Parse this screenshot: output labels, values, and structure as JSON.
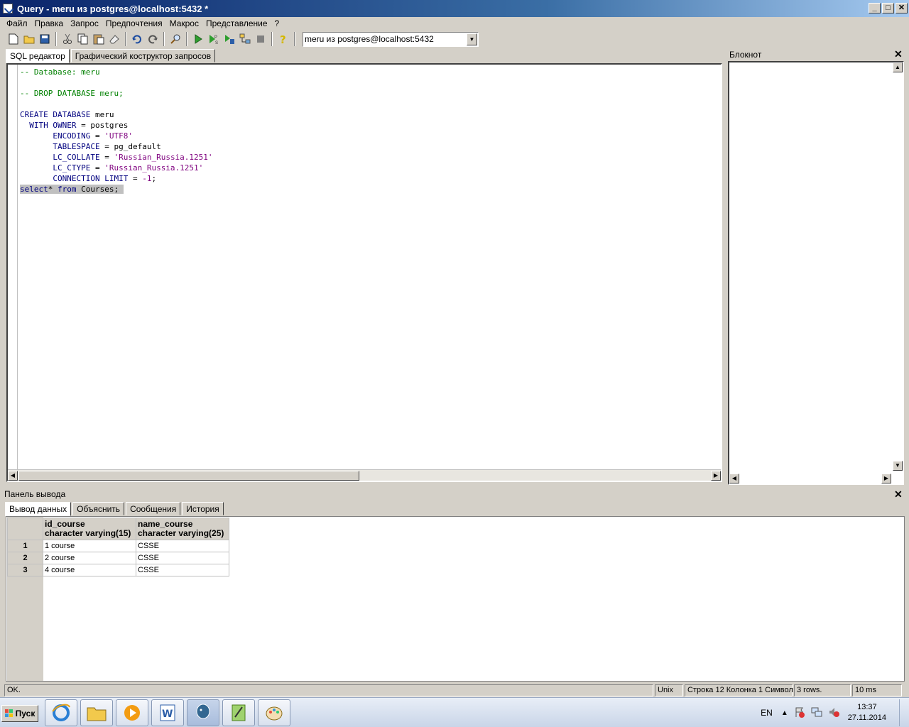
{
  "window": {
    "title": "Query - meru из postgres@localhost:5432 *",
    "buttons": [
      "_",
      "□",
      "✕"
    ]
  },
  "menu": [
    "Файл",
    "Правка",
    "Запрос",
    "Предпочтения",
    "Макрос",
    "Представление",
    "?"
  ],
  "toolbar": {
    "icons": [
      "new-file-icon",
      "open-folder-icon",
      "save-icon",
      "cut-icon",
      "copy-icon",
      "paste-icon",
      "clear-icon",
      "undo-icon",
      "redo-icon",
      "find-icon",
      "execute-icon",
      "execute-pgscript-icon",
      "execute-to-file-icon",
      "explain-icon",
      "stop-icon",
      "help-icon"
    ],
    "connection": "meru из postgres@localhost:5432"
  },
  "editor_tabs": [
    "SQL редактор",
    "Графический коструктор запросов"
  ],
  "editor": {
    "lines": {
      "l1": "-- Database: meru",
      "l3": "-- DROP DATABASE meru;",
      "l5_kw1": "CREATE",
      "l5_kw2": "DATABASE",
      "l5_name": "meru",
      "l6_kw1": "WITH",
      "l6_kw2": "OWNER",
      "l6_rest": "= postgres",
      "l7_kw": "ENCODING",
      "l7_eq": "=",
      "l7_str": "'UTF8'",
      "l8_kw": "TABLESPACE",
      "l8_rest": "= pg_default",
      "l9_kw": "LC_COLLATE",
      "l9_eq": "=",
      "l9_str": "'Russian_Russia.1251'",
      "l10_kw": "LC_CTYPE",
      "l10_eq": "=",
      "l10_str": "'Russian_Russia.1251'",
      "l11_kw": "CONNECTION LIMIT",
      "l11_eq": "=",
      "l11_num": "-1",
      "l11_end": ";",
      "l12_kw1": "select",
      "l12_mid": "* ",
      "l12_kw2": "from",
      "l12_rest": " Courses;"
    }
  },
  "notepad": {
    "title": "Блокнот",
    "close": "✕"
  },
  "output": {
    "title": "Панель вывода",
    "close": "✕",
    "tabs": [
      "Вывод данных",
      "Объяснить",
      "Сообщения",
      "История"
    ],
    "columns": [
      {
        "name": "id_course",
        "type": "character varying(15)"
      },
      {
        "name": "name_course",
        "type": "character varying(25)"
      }
    ],
    "rows": [
      {
        "n": "1",
        "cells": [
          "1 course",
          "CSSE"
        ]
      },
      {
        "n": "2",
        "cells": [
          "2 course",
          "CSSE"
        ]
      },
      {
        "n": "3",
        "cells": [
          "4 course",
          "CSSE"
        ]
      }
    ]
  },
  "status": {
    "message": "OK.",
    "format": "Unix",
    "position": "Строка 12 Колонка 1 Символ",
    "rows": "3 rows.",
    "time": "10 ms"
  },
  "taskbar": {
    "start": "Пуск",
    "apps": [
      "ie-icon",
      "explorer-icon",
      "media-player-icon",
      "word-icon",
      "pgadmin-icon",
      "notepadpp-icon",
      "paint-icon"
    ],
    "lang": "EN",
    "time": "13:37",
    "date": "27.11.2014"
  }
}
